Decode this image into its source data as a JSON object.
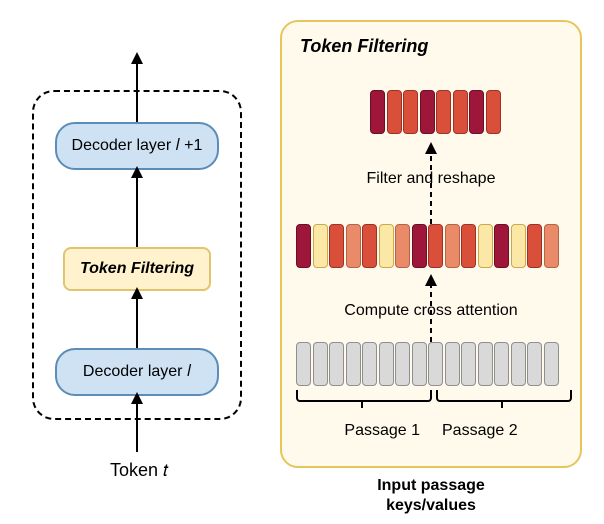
{
  "left": {
    "decoder_top": "Decoder layer 𝑙 +1",
    "decoder_bot": "Decoder layer 𝑙",
    "token_filter": "Token Filtering",
    "token_t": "Token 𝑡"
  },
  "right": {
    "title": "Token Filtering",
    "filter_reshape": "Filter and reshape",
    "compute_xattn": "Compute cross attention",
    "passage1": "Passage 1",
    "passage2": "Passage 2",
    "input_keys": "Input passage",
    "input_keys2": "keys/values"
  },
  "chart_data": {
    "type": "diagram",
    "description": "Token Filtering module inserted between two decoder layers. Right panel expands the module: grey tokens from two input passages receive per-token cross-attention scores (heat-colored), then top-scoring tokens are filtered and reshaped into a compact block for the next layer.",
    "left_stack": [
      "Decoder layer l",
      "Token Filtering",
      "Decoder layer l+1"
    ],
    "right_steps": [
      "Input passage keys/values (Passage 1, Passage 2)",
      "Compute cross attention",
      "Filter and reshape"
    ],
    "token_counts": {
      "input_per_passage": 8,
      "filtered_output": 8
    },
    "attention_heat_levels": [
      "low(yellow)",
      "mid(orange)",
      "high(dark-red)"
    ]
  }
}
